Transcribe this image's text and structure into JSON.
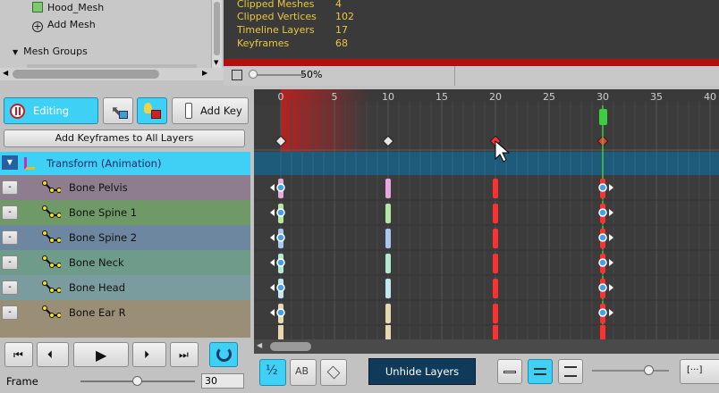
{
  "hierarchy": {
    "items": [
      {
        "label": "Hood_Mesh"
      },
      {
        "label": "Add Mesh"
      },
      {
        "label": "Mesh Groups"
      }
    ]
  },
  "stats": [
    {
      "label": "Clipped Meshes",
      "value": "4"
    },
    {
      "label": "Clipped Vertices",
      "value": "102"
    },
    {
      "label": "Timeline Layers",
      "value": "17"
    },
    {
      "label": "Keyframes",
      "value": "68"
    }
  ],
  "zoom": {
    "label": "50%"
  },
  "toolbar": {
    "editing_label": "Editing",
    "add_key_label": "Add Key",
    "add_all_label": "Add Keyframes to All Layers"
  },
  "transform_row": {
    "label": "Transform (Animation)"
  },
  "layers": [
    {
      "label": "Bone Pelvis",
      "color": "#8e7d8f",
      "key_color": "#e6a8e0"
    },
    {
      "label": "Bone Spine 1",
      "color": "#6f9a68",
      "key_color": "#b4e6a4"
    },
    {
      "label": "Bone Spine 2",
      "color": "#6d87a0",
      "key_color": "#a8c8f0"
    },
    {
      "label": "Bone Neck",
      "color": "#6f9c8a",
      "key_color": "#b4e8d4"
    },
    {
      "label": "Bone Head",
      "color": "#7a9c9e",
      "key_color": "#c0e8ee"
    },
    {
      "label": "Bone Ear R",
      "color": "#9a8e76",
      "key_color": "#e8d8b0"
    }
  ],
  "ruler": {
    "ticks": [
      "0",
      "5",
      "10",
      "15",
      "20",
      "25",
      "30",
      "35",
      "40"
    ]
  },
  "frame": {
    "label": "Frame",
    "value": "30"
  },
  "bottom": {
    "unhide_label": "Unhide Layers"
  },
  "colors": {
    "accent": "#3fd0f5",
    "playhead": "#3fcc3f",
    "keyframe": "#ff3030"
  }
}
